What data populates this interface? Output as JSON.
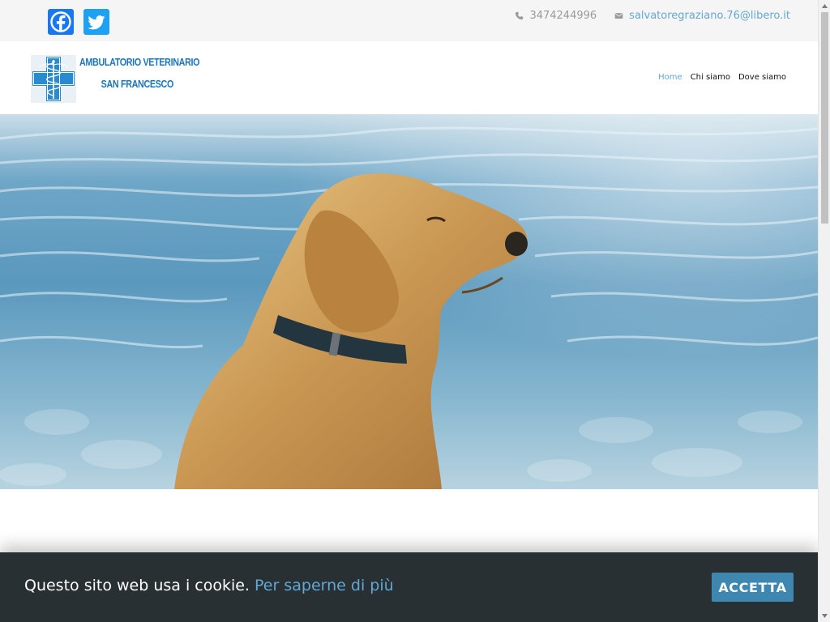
{
  "topbar": {
    "social": [
      {
        "name": "Facebook",
        "icon": "facebook-icon",
        "color": "#1877f2"
      },
      {
        "name": "Twitter",
        "icon": "twitter-icon",
        "color": "#1da1f2"
      }
    ],
    "phone": "3474244996",
    "phone_icon": "phone-icon",
    "email": "salvatoregraziano.76@libero.it",
    "email_icon": "envelope-icon"
  },
  "header": {
    "brand_line1": "AMBULATORIO VETERINARIO",
    "brand_line2": "SAN FRANCESCO",
    "logo_icon": "veterinary-cross-caduceus-icon",
    "nav": [
      {
        "label": "Home",
        "active": true
      },
      {
        "label": "Chi siamo",
        "active": false
      },
      {
        "label": "Dove siamo",
        "active": false
      }
    ]
  },
  "cookie_banner": {
    "text": "Questo sito web usa i cookie.",
    "link_text": "Per saperne di più",
    "accept_label": "ACCETTA"
  },
  "colors": {
    "accent": "#62a8d2",
    "brand": "#1b76bc",
    "cookie_bg": "#283033",
    "accept_button": "#3d87b0"
  }
}
